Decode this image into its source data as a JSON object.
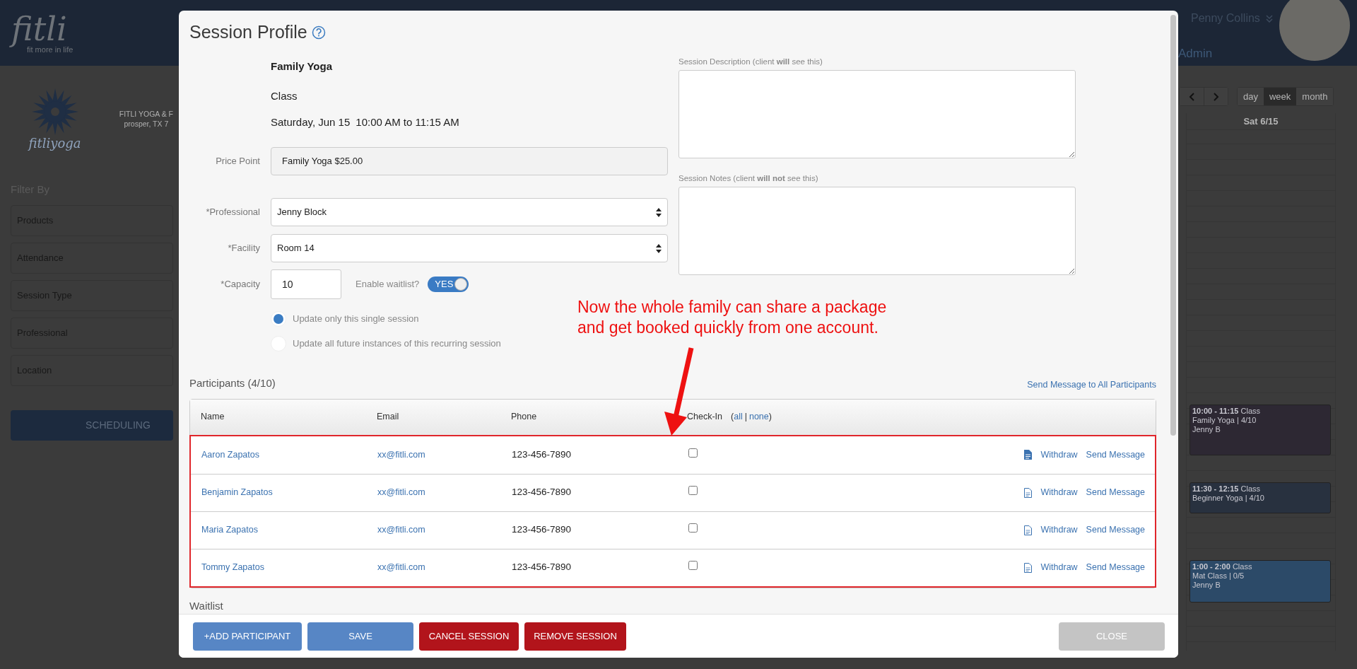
{
  "app_header": {
    "logo_text": "fitli",
    "tagline": "fit more in life",
    "user_name": "Penny Collins",
    "role": "Admin"
  },
  "sidebar": {
    "brand_text": "fitliyoga",
    "address_lines": [
      "FITLI YOGA & F",
      "prosper, TX 7"
    ],
    "filter_title": "Filter By",
    "filters": [
      "Products",
      "Attendance",
      "Session Type",
      "Professional",
      "Location"
    ],
    "scheduling_button": "SCHEDULING"
  },
  "calendar": {
    "views": [
      {
        "label": "day",
        "selected": false
      },
      {
        "label": "week",
        "selected": true
      },
      {
        "label": "month",
        "selected": false
      }
    ],
    "day_header": "Sat 6/15",
    "events": [
      {
        "time": "10:00 - 11:15",
        "type": "Class",
        "title": "Family Yoga | 4/10",
        "professional": "Jenny B",
        "color": "#2d2833"
      },
      {
        "time": "11:30 - 12:15",
        "type": "Class",
        "title": "Beginner Yoga | 4/10",
        "color": "#28313f"
      },
      {
        "time": "1:00 - 2:00",
        "type": "Class",
        "title": "Mat Class | 0/5",
        "professional": "Jenny B",
        "color": "#2c4a68"
      }
    ]
  },
  "modal": {
    "title": "Session Profile",
    "session_name": "Family Yoga",
    "session_type": "Class",
    "date": "Saturday, Jun 15",
    "time": "10:00 AM to 11:15 AM",
    "price_point": {
      "label": "Price Point",
      "value": "Family Yoga $25.00"
    },
    "professional": {
      "label": "*Professional",
      "value": "Jenny Block"
    },
    "facility": {
      "label": "*Facility",
      "value": "Room 14"
    },
    "capacity": {
      "label": "*Capacity",
      "value": "10"
    },
    "waitlist": {
      "label": "Enable waitlist?",
      "toggle_text": "YES",
      "on": true
    },
    "update_options": [
      {
        "label": "Update only this single session",
        "selected": true
      },
      {
        "label": "Update all future instances of this recurring session",
        "selected": false
      }
    ],
    "description": {
      "label": "Session Description (client **will** see this)"
    },
    "notes": {
      "label": "Session Notes (client **will not** see this)"
    },
    "participants": {
      "title": "Participants (4/10)",
      "send_all": "Send Message to All Participants",
      "columns": [
        "Name",
        "Email",
        "Phone",
        "Check-In"
      ],
      "check_links": {
        "open": "(",
        "all": "all",
        "separator": "|",
        "none": "none",
        "close": ")"
      },
      "rows": [
        {
          "name": "Aaron Zapatos",
          "email": "xx@fitli.com",
          "phone": "123-456-7890",
          "checked": false,
          "note_filled": true,
          "withdraw": "Withdraw",
          "send": "Send Message"
        },
        {
          "name": "Benjamin Zapatos",
          "email": "xx@fitli.com",
          "phone": "123-456-7890",
          "checked": false,
          "note_filled": false,
          "withdraw": "Withdraw",
          "send": "Send Message"
        },
        {
          "name": "Maria Zapatos",
          "email": "xx@fitli.com",
          "phone": "123-456-7890",
          "checked": false,
          "note_filled": false,
          "withdraw": "Withdraw",
          "send": "Send Message"
        },
        {
          "name": "Tommy Zapatos",
          "email": "xx@fitli.com",
          "phone": "123-456-7890",
          "checked": false,
          "note_filled": false,
          "withdraw": "Withdraw",
          "send": "Send Message"
        }
      ]
    },
    "waitlist_title": "Waitlist",
    "buttons": [
      {
        "label": "+ADD PARTICIPANT",
        "kind": "primary"
      },
      {
        "label": "SAVE",
        "kind": "primary"
      },
      {
        "label": "CANCEL SESSION",
        "kind": "danger"
      },
      {
        "label": "REMOVE SESSION",
        "kind": "danger"
      },
      {
        "label": "CLOSE",
        "kind": "disabled"
      }
    ]
  },
  "annotation": {
    "text": "Now the whole family can share a package\nand get booked quickly from one account."
  }
}
